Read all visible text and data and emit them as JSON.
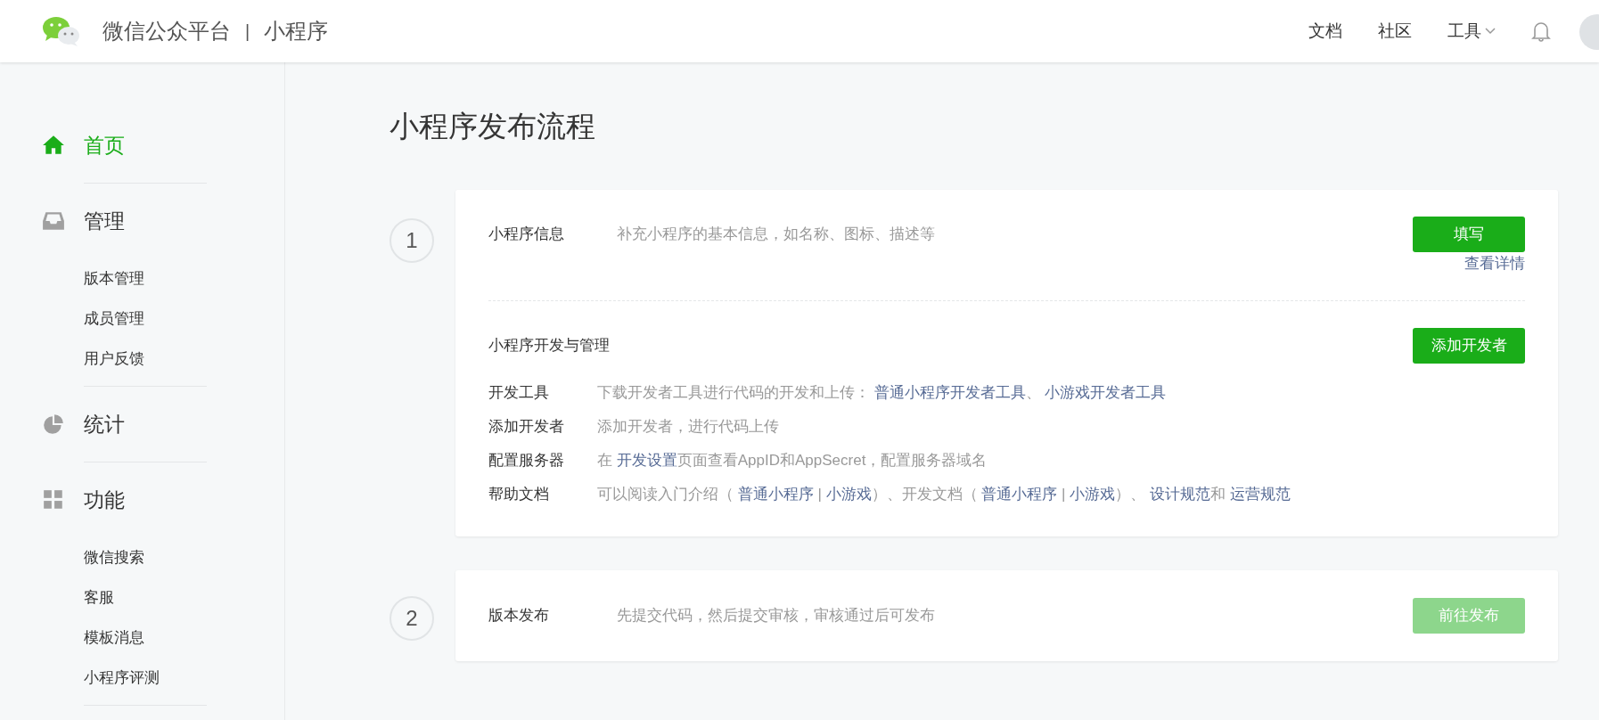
{
  "header": {
    "brand": "微信公众平台",
    "divider": "|",
    "product": "小程序",
    "nav": [
      {
        "label": "文档",
        "dropdown": false
      },
      {
        "label": "社区",
        "dropdown": false
      },
      {
        "label": "工具",
        "dropdown": true
      }
    ]
  },
  "sidebar": {
    "groups": [
      {
        "kind": "home",
        "label": "首页",
        "selected": true
      },
      {
        "kind": "inbox",
        "label": "管理",
        "selected": false,
        "items": [
          {
            "label": "版本管理"
          },
          {
            "label": "成员管理"
          },
          {
            "label": "用户反馈"
          }
        ]
      },
      {
        "kind": "pie",
        "label": "统计",
        "selected": false
      },
      {
        "kind": "grid",
        "label": "功能",
        "selected": false,
        "items": [
          {
            "label": "微信搜索"
          },
          {
            "label": "客服"
          },
          {
            "label": "模板消息"
          },
          {
            "label": "小程序评测"
          }
        ]
      }
    ]
  },
  "page_title": "小程序发布流程",
  "steps": [
    {
      "number": "1",
      "sections": [
        {
          "kind": "info",
          "title": "小程序信息",
          "description": "补充小程序的基本信息，如名称、图标、描述等",
          "button": {
            "label": "填写",
            "enabled": true
          },
          "link": "查看详情"
        },
        {
          "kind": "dev",
          "title": "小程序开发与管理",
          "button": {
            "label": "添加开发者",
            "enabled": true
          },
          "rows": [
            {
              "label": "开发工具",
              "segments": [
                {
                  "kind": "text",
                  "text": "下载开发者工具进行代码的开发和上传： "
                },
                {
                  "kind": "link",
                  "text": "普通小程序开发者工具"
                },
                {
                  "kind": "text",
                  "text": "、 "
                },
                {
                  "kind": "link",
                  "text": "小游戏开发者工具"
                }
              ]
            },
            {
              "label": "添加开发者",
              "segments": [
                {
                  "kind": "text",
                  "text": "添加开发者，进行代码上传"
                }
              ]
            },
            {
              "label": "配置服务器",
              "segments": [
                {
                  "kind": "text",
                  "text": "在 "
                },
                {
                  "kind": "link",
                  "text": "开发设置"
                },
                {
                  "kind": "text",
                  "text": "页面查看AppID和AppSecret，配置服务器域名"
                }
              ]
            },
            {
              "label": "帮助文档",
              "segments": [
                {
                  "kind": "text",
                  "text": "可以阅读入门介绍（ "
                },
                {
                  "kind": "link",
                  "text": "普通小程序"
                },
                {
                  "kind": "text",
                  "text": " | "
                },
                {
                  "kind": "link",
                  "text": "小游戏"
                },
                {
                  "kind": "text",
                  "text": "）、开发文档（ "
                },
                {
                  "kind": "link",
                  "text": "普通小程序"
                },
                {
                  "kind": "text",
                  "text": " | "
                },
                {
                  "kind": "link",
                  "text": "小游戏"
                },
                {
                  "kind": "text",
                  "text": "）、 "
                },
                {
                  "kind": "link",
                  "text": "设计规范"
                },
                {
                  "kind": "text",
                  "text": "和 "
                },
                {
                  "kind": "link",
                  "text": "运营规范"
                }
              ]
            }
          ]
        }
      ]
    },
    {
      "number": "2",
      "sections": [
        {
          "kind": "info",
          "title": "版本发布",
          "description": "先提交代码，然后提交审核，审核通过后可发布",
          "button": {
            "label": "前往发布",
            "enabled": false
          }
        }
      ]
    }
  ]
}
